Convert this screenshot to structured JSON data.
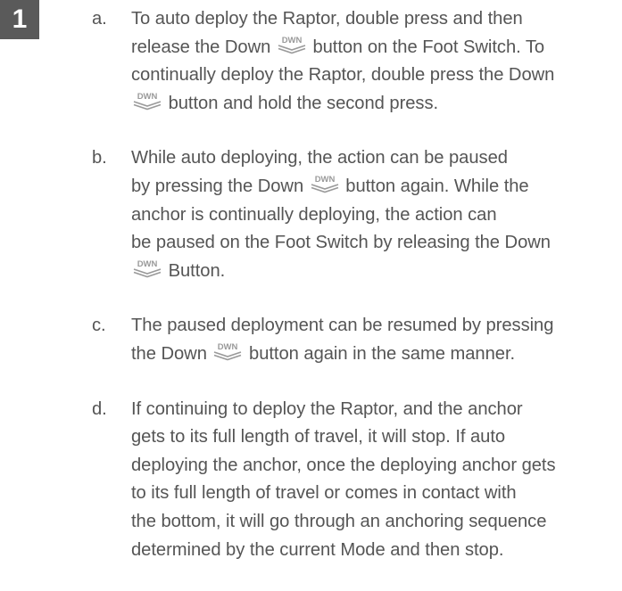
{
  "step_number": "1",
  "icon": {
    "name": "dwn-button-icon",
    "label": "DWN",
    "color": "#9a9a9a"
  },
  "items": [
    {
      "letter": "a.",
      "lines": [
        [
          "To auto deploy the Raptor, double press and then"
        ],
        [
          "release the Down",
          "icon",
          "button on the Foot Switch. To"
        ],
        [
          "continually deploy the Raptor, double press the Down"
        ],
        [
          "icon",
          "button and hold the second press."
        ]
      ]
    },
    {
      "letter": "b.",
      "lines": [
        [
          "While auto deploying, the action can be paused"
        ],
        [
          "by pressing the Down",
          "icon",
          "button again. While the"
        ],
        [
          "anchor is continually deploying, the action can"
        ],
        [
          "be paused on the Foot Switch by releasing the Down"
        ],
        [
          "icon",
          "Button."
        ]
      ]
    },
    {
      "letter": "c.",
      "lines": [
        [
          "The paused deployment can be resumed by pressing"
        ],
        [
          "the Down",
          "icon",
          "button again in the same manner."
        ]
      ]
    },
    {
      "letter": "d.",
      "lines": [
        [
          "If continuing to deploy the Raptor, and the anchor"
        ],
        [
          "gets to its full length of travel, it will stop. If auto"
        ],
        [
          "deploying the anchor, once the deploying anchor gets"
        ],
        [
          "to its full length of travel or comes in contact with"
        ],
        [
          "the bottom, it will go through an anchoring sequence"
        ],
        [
          "determined by the current Mode and then stop."
        ]
      ]
    }
  ]
}
